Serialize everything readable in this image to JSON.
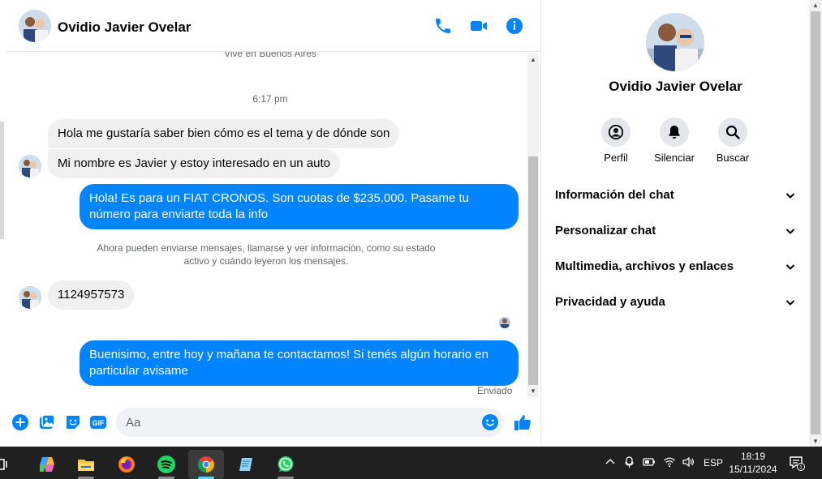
{
  "colors": {
    "accent": "#0084ff",
    "incoming_bubble": "#f0f0f0",
    "taskbar": "#202020"
  },
  "chat": {
    "contact_name": "Ovidio Javier Ovelar",
    "header_icons": [
      "phone-icon",
      "video-call-icon",
      "info-icon"
    ],
    "faded_top_text": "Vive en Buenos Aires",
    "time_separator": "6:17 pm",
    "messages": [
      {
        "from": "contact",
        "text": "Hola me gustaría saber bien cómo es el tema y de dónde son"
      },
      {
        "from": "contact",
        "text": "Mi nombre es Javier y estoy interesado en un auto"
      },
      {
        "from": "me",
        "text": "Hola! Es para un FIAT CRONOS. Son cuotas de $235.000. Pasame tu número para enviarte toda la info"
      },
      {
        "from": "contact",
        "text": "1124957573"
      },
      {
        "from": "me",
        "text": "Buenisimo, entre hoy y mañana te contactamos! Si tenés algún horario en particular avisame"
      }
    ],
    "system_note": "Ahora pueden enviarse mensajes, llamarse y ver información, como su estado activo y cuándo leyeron los mensajes.",
    "status": "Enviado",
    "composer": {
      "placeholder": "Aa",
      "icons": [
        "add-icon",
        "photo-icon",
        "sticker-icon",
        "gif-icon",
        "emoji-icon",
        "thumbs-up-icon"
      ],
      "gif_label": "GIF"
    }
  },
  "panel": {
    "name": "Ovidio Javier Ovelar",
    "actions": [
      {
        "label": "Perfil",
        "icon": "profile-icon"
      },
      {
        "label": "Silenciar",
        "icon": "bell-icon"
      },
      {
        "label": "Buscar",
        "icon": "search-icon"
      }
    ],
    "sections": [
      "Información del chat",
      "Personalizar chat",
      "Multimedia, archivos y enlaces",
      "Privacidad y ayuda"
    ]
  },
  "taskbar": {
    "apps": [
      "task-view-icon",
      "copilot-icon",
      "file-explorer-icon",
      "firefox-icon",
      "spotify-icon",
      "chrome-icon",
      "notepad-icon",
      "whatsapp-icon"
    ],
    "language": "ESP",
    "time": "18:19",
    "date": "15/11/2024",
    "notification_count": "1"
  }
}
